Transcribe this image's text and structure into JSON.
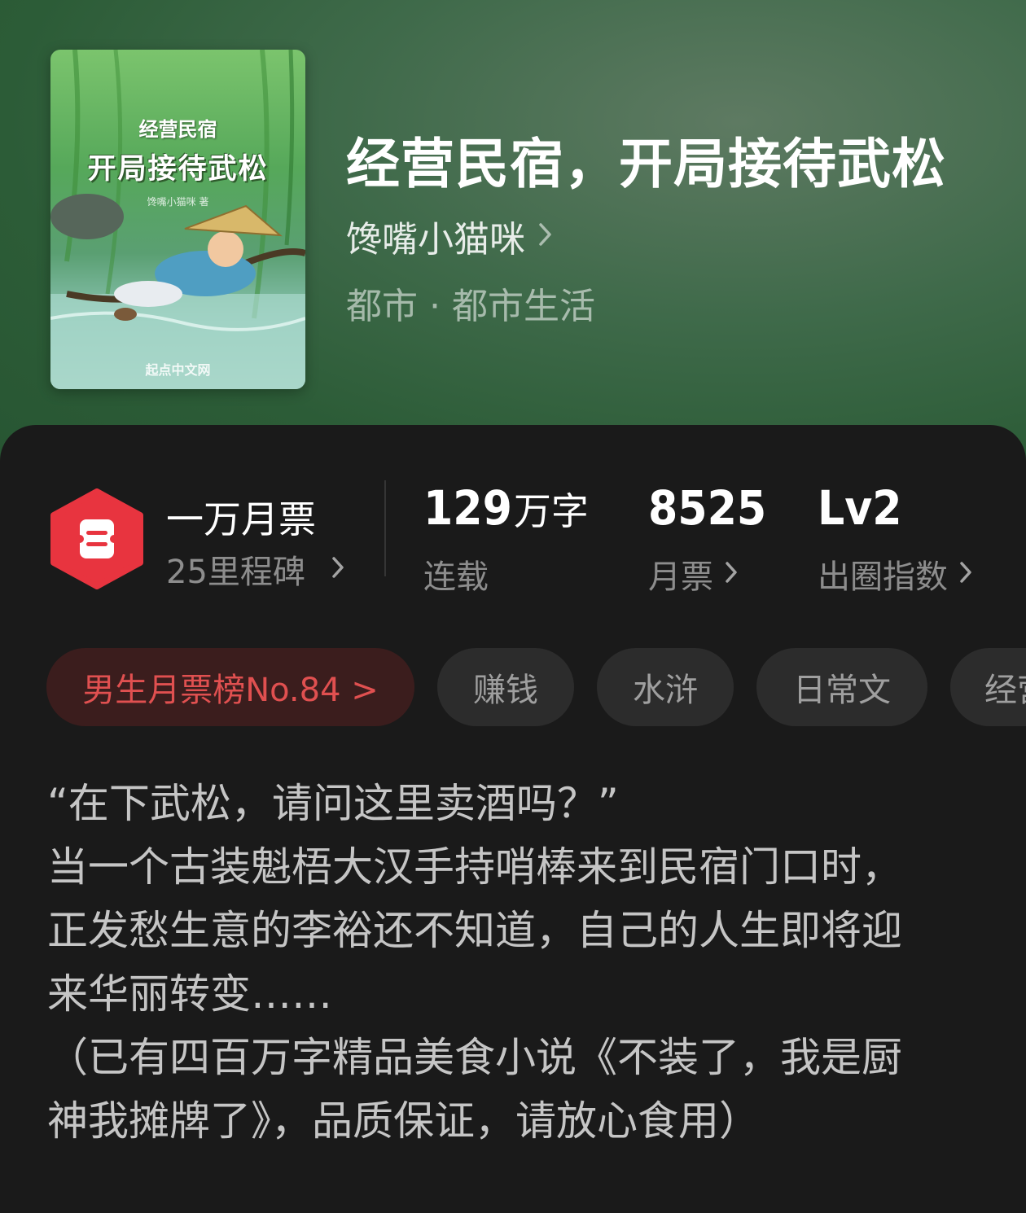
{
  "book": {
    "title": "经营民宿，开局接待武松",
    "author": "馋嘴小猫咪",
    "genre": "都市 · 都市生活"
  },
  "cover": {
    "series": "经营民宿",
    "title": "开局接待武松",
    "author": "馋嘴小猫咪 著",
    "publisher": "起点中文网"
  },
  "milestone": {
    "title": "一万月票",
    "sub": "25里程碑",
    "badge_icon": "ticket-icon",
    "badge_color": "#e8343f"
  },
  "stats": {
    "words": {
      "value": "129",
      "unit": "万字",
      "label": "连载"
    },
    "monthly_tickets": {
      "value": "8525",
      "label": "月票"
    },
    "level": {
      "value": "Lv2",
      "label": "出圈指数"
    }
  },
  "tags": {
    "rank": "男生月票榜No.84 >",
    "items": [
      "赚钱",
      "水浒",
      "日常文",
      "经营"
    ]
  },
  "synopsis": [
    "“在下武松，请问这里卖酒吗？”",
    "当一个古装魁梧大汉手持哨棒来到民宿门口时，",
    "正发愁生意的李裕还不知道，自己的人生即将迎",
    "来华丽转变……",
    "（已有四百万字精品美食小说《不装了，我是厨",
    "神我摊牌了》，品质保证，请放心食用）"
  ],
  "colors": {
    "accent_red": "#e05050",
    "hero_green": "#2c5c37",
    "sheet_bg": "#1a1a1a"
  }
}
